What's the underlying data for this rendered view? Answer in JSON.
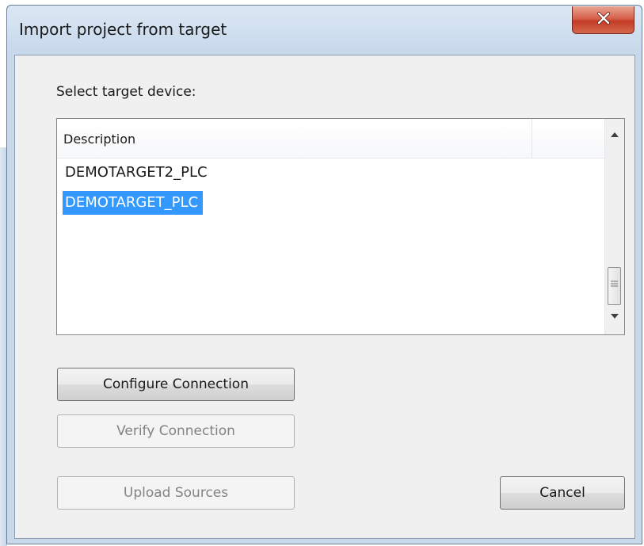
{
  "window": {
    "title": "Import project from target"
  },
  "dialog": {
    "select_label": "Select target device:",
    "list": {
      "columns": [
        "Description"
      ],
      "rows": [
        "DEMOTARGET2_PLC",
        "DEMOTARGET_PLC"
      ],
      "selected_index": 1
    },
    "buttons": {
      "configure": "Configure Connection",
      "verify": "Verify Connection",
      "upload": "Upload Sources",
      "cancel": "Cancel"
    }
  },
  "colors": {
    "selection": "#3399ff",
    "close_button": "#c43c25",
    "dialog_background": "#f0f0f0",
    "frame": "#c9d9ea"
  },
  "icons": [
    "close-icon",
    "scroll-up-icon",
    "scroll-down-icon",
    "scroll-grip-icon"
  ]
}
